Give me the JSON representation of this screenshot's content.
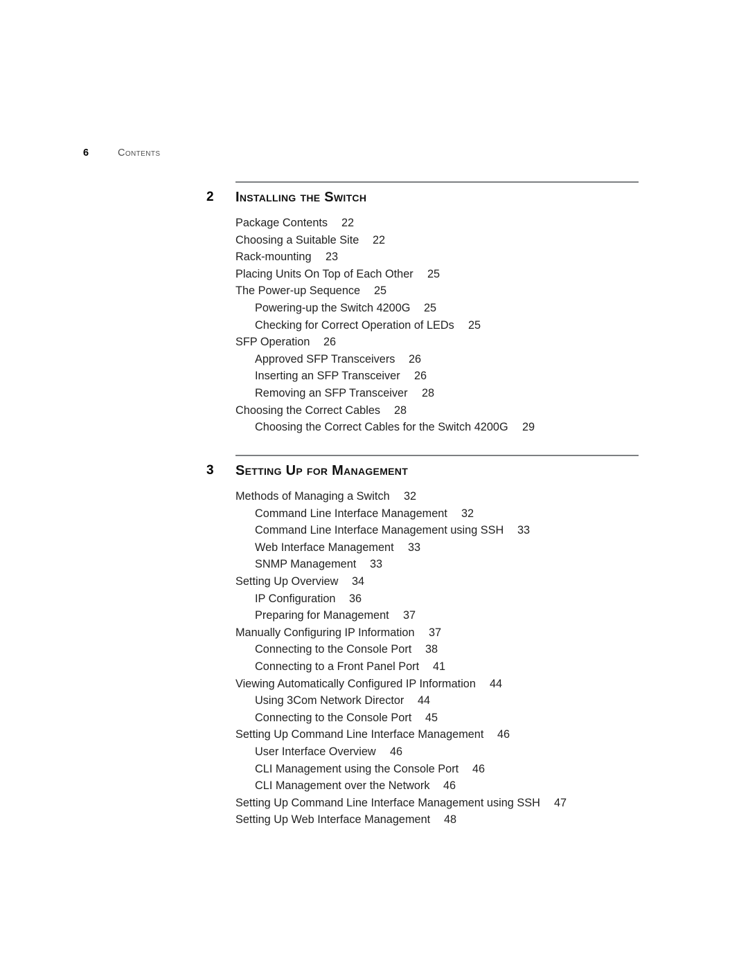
{
  "header": {
    "folio": "6",
    "title": "Contents"
  },
  "chapters": [
    {
      "number": "2",
      "title": "Installing the Switch",
      "entries": [
        {
          "level": 1,
          "text": "Package Contents",
          "page": "22"
        },
        {
          "level": 1,
          "text": "Choosing a Suitable Site",
          "page": "22"
        },
        {
          "level": 1,
          "text": "Rack-mounting",
          "page": "23"
        },
        {
          "level": 1,
          "text": "Placing Units On Top of Each Other",
          "page": "25"
        },
        {
          "level": 1,
          "text": "The Power-up Sequence",
          "page": "25"
        },
        {
          "level": 2,
          "text": "Powering-up the Switch 4200G",
          "page": "25"
        },
        {
          "level": 2,
          "text": "Checking for Correct Operation of LEDs",
          "page": "25"
        },
        {
          "level": 1,
          "text": "SFP Operation",
          "page": "26"
        },
        {
          "level": 2,
          "text": "Approved SFP Transceivers",
          "page": "26"
        },
        {
          "level": 2,
          "text": "Inserting an SFP Transceiver",
          "page": "26"
        },
        {
          "level": 2,
          "text": "Removing an SFP Transceiver",
          "page": "28"
        },
        {
          "level": 1,
          "text": "Choosing the Correct Cables",
          "page": "28"
        },
        {
          "level": 2,
          "text": "Choosing the Correct Cables for the Switch 4200G",
          "page": "29"
        }
      ]
    },
    {
      "number": "3",
      "title": "Setting Up for Management",
      "entries": [
        {
          "level": 1,
          "text": "Methods of Managing a Switch",
          "page": "32"
        },
        {
          "level": 2,
          "text": "Command Line Interface Management",
          "page": "32"
        },
        {
          "level": 2,
          "text": "Command Line Interface Management using SSH",
          "page": "33"
        },
        {
          "level": 2,
          "text": "Web Interface Management",
          "page": "33"
        },
        {
          "level": 2,
          "text": "SNMP Management",
          "page": "33"
        },
        {
          "level": 1,
          "text": "Setting Up Overview",
          "page": "34"
        },
        {
          "level": 2,
          "text": "IP Configuration",
          "page": "36"
        },
        {
          "level": 2,
          "text": "Preparing for Management",
          "page": "37"
        },
        {
          "level": 1,
          "text": "Manually Configuring IP Information",
          "page": "37"
        },
        {
          "level": 2,
          "text": "Connecting to the Console Port",
          "page": "38"
        },
        {
          "level": 2,
          "text": "Connecting to a Front Panel Port",
          "page": "41"
        },
        {
          "level": 1,
          "text": "Viewing Automatically Configured IP Information",
          "page": "44"
        },
        {
          "level": 2,
          "text": "Using 3Com Network Director",
          "page": "44"
        },
        {
          "level": 2,
          "text": "Connecting to the Console Port",
          "page": "45"
        },
        {
          "level": 1,
          "text": "Setting Up Command Line Interface Management",
          "page": "46"
        },
        {
          "level": 2,
          "text": "User Interface Overview",
          "page": "46"
        },
        {
          "level": 2,
          "text": "CLI Management using the Console Port",
          "page": "46"
        },
        {
          "level": 2,
          "text": "CLI Management over the Network",
          "page": "46"
        },
        {
          "level": 1,
          "text": "Setting Up Command Line Interface Management using SSH",
          "page": "47"
        },
        {
          "level": 1,
          "text": "Setting Up Web Interface Management",
          "page": "48"
        }
      ]
    }
  ],
  "layout": {
    "chapter_tops": [
      262,
      657
    ],
    "rule_color": "#7d7f82"
  }
}
